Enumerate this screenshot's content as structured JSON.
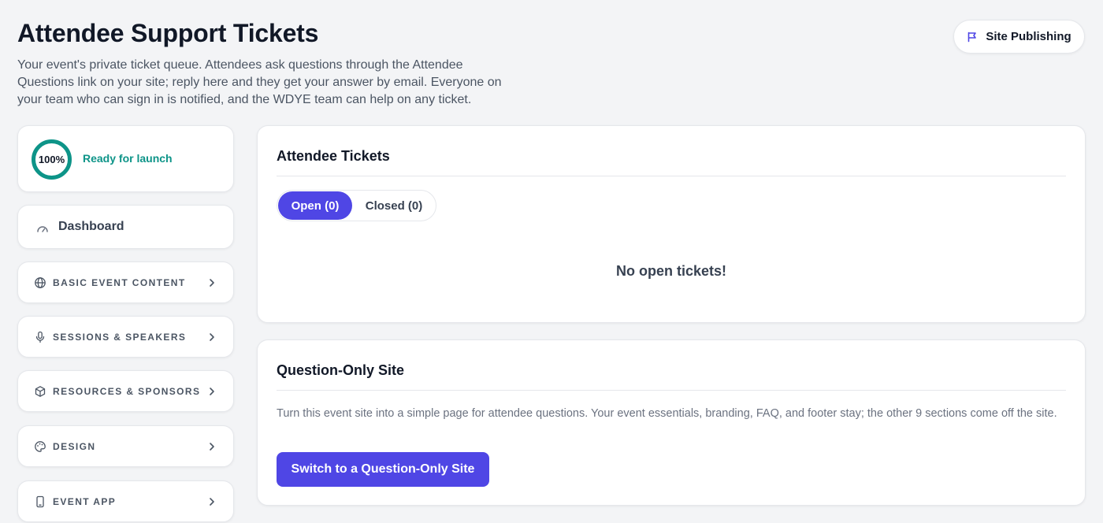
{
  "header": {
    "title": "Attendee Support Tickets",
    "subtitle": "Your event's private ticket queue. Attendees ask questions through the Attendee Questions link on your site; reply here and they get your answer by email. Everyone on your team who can sign in is notified, and the WDYE team can help on any ticket.",
    "publish_button": {
      "label": "Site Publishing",
      "icon": "flag-icon"
    }
  },
  "sidebar": {
    "progress": {
      "percent": 100,
      "label": "100%",
      "status": "Ready for launch"
    },
    "dashboard": {
      "label": "Dashboard",
      "icon": "gauge-icon"
    },
    "items": [
      {
        "label": "BASIC EVENT CONTENT",
        "icon": "globe-icon"
      },
      {
        "label": "SESSIONS & SPEAKERS",
        "icon": "microphone-icon"
      },
      {
        "label": "RESOURCES & SPONSORS",
        "icon": "box-icon"
      },
      {
        "label": "DESIGN",
        "icon": "palette-icon"
      },
      {
        "label": "EVENT APP",
        "icon": "phone-icon"
      }
    ]
  },
  "tickets": {
    "title": "Attendee Tickets",
    "tabs": [
      {
        "label": "Open (0)",
        "active": true
      },
      {
        "label": "Closed (0)",
        "active": false
      }
    ],
    "empty_message": "No open tickets!"
  },
  "question_only": {
    "title": "Question-Only Site",
    "description": "Turn this event site into a simple page for attendee questions. Your event essentials, branding, FAQ, and footer stay; the other 9 sections come off the site.",
    "button_label": "Switch to a Question-Only Site"
  },
  "colors": {
    "accent": "#4f46e5",
    "success": "#0d9488",
    "background": "#f3f4f6"
  }
}
